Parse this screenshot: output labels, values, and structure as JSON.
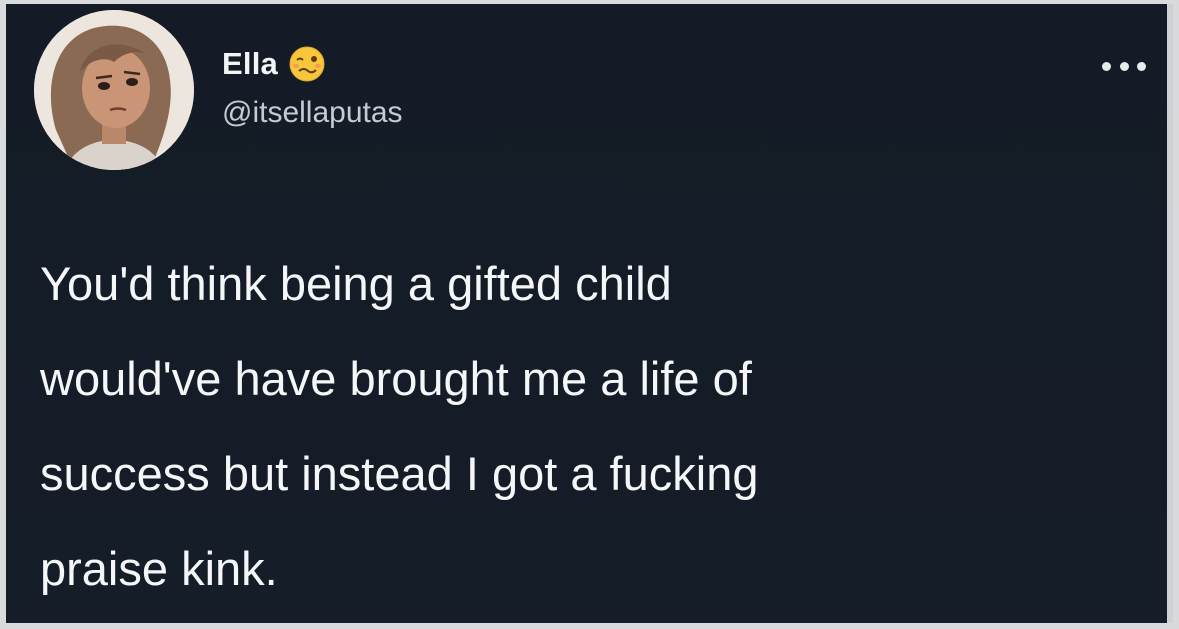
{
  "tweet": {
    "author": {
      "display_name": "Ella",
      "handle": "@itsellaputas",
      "avatar_icon": "cartoon-woman-portrait",
      "name_emoji_icon": "woozy-face-emoji"
    },
    "menu_icon": "more-options-ellipsis-icon",
    "text_lines": [
      "You'd think being a gifted child",
      "would've have brought me a life of",
      "success but instead I got a fucking",
      "praise kink."
    ],
    "colors": {
      "background": "#151d28",
      "primary_text": "#f4f6f7",
      "secondary_text": "#c4cbd1",
      "emoji": "#f7c63a"
    }
  }
}
